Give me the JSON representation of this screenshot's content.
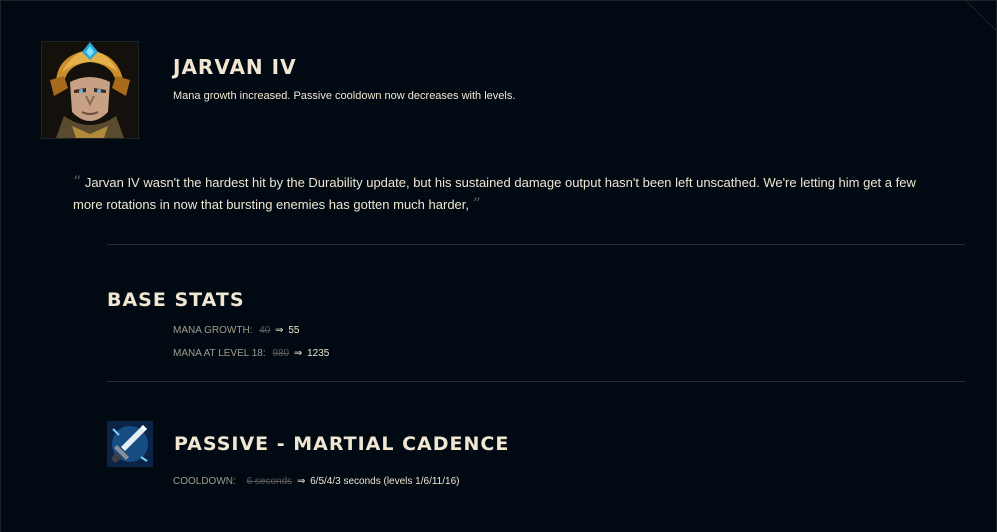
{
  "champion": {
    "name": "JARVAN IV",
    "summary": "Mana growth increased. Passive cooldown now decreases with levels.",
    "quote": "Jarvan IV wasn't the hardest hit by the Durability update, but his sustained damage output hasn't been left unscathed. We're letting him get a few more rotations in now that bursting enemies has gotten much harder,"
  },
  "base_stats": {
    "title": "BASE STATS",
    "rows": [
      {
        "label": "MANA GROWTH:",
        "old": "40",
        "arrow": "⇒",
        "new": "55"
      },
      {
        "label": "MANA AT LEVEL 18:",
        "old": "980",
        "arrow": "⇒",
        "new": "1235"
      }
    ]
  },
  "passive": {
    "title": "PASSIVE - MARTIAL CADENCE",
    "rows": [
      {
        "label": "COOLDOWN:",
        "old": "6 seconds",
        "arrow": "⇒",
        "new": "6/5/4/3 seconds (levels 1/6/11/16)"
      }
    ]
  },
  "colors": {
    "background": "#010a13",
    "text": "#f0e6d2",
    "muted": "#a09b8c",
    "struck": "#5b5a56",
    "divider": "#2a2e33"
  }
}
